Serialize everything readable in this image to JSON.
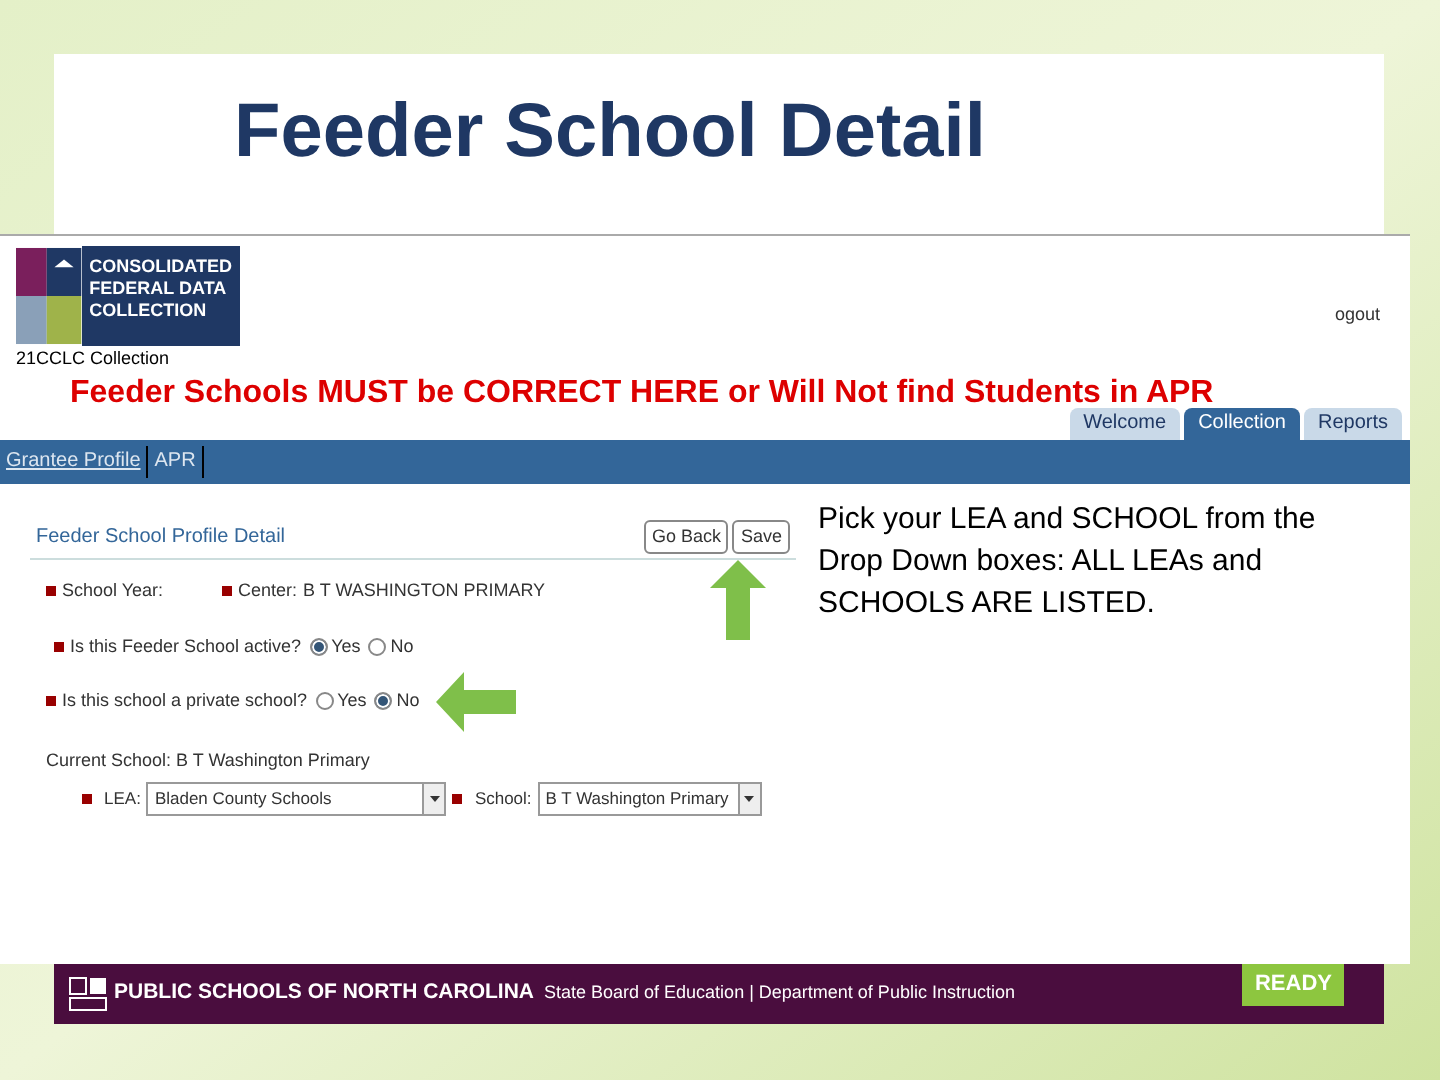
{
  "slide": {
    "title": "Feeder School Detail"
  },
  "banner": {
    "logo_lines": [
      "CONSOLIDATED",
      "FEDERAL DATA",
      "COLLECTION"
    ],
    "collection": "21CCLC Collection",
    "logout": "ogout",
    "notice": "Feeder Schools MUST be CORRECT HERE or Will Not find Students in APR"
  },
  "tabs": [
    {
      "label": "Welcome",
      "selected": false
    },
    {
      "label": "Collection",
      "selected": true
    },
    {
      "label": "Reports",
      "selected": false
    }
  ],
  "nav": [
    "Grantee Profile",
    "APR"
  ],
  "form": {
    "heading": "Feeder School Profile Detail",
    "buttons": [
      "Go Back",
      "Save"
    ],
    "school_year": {
      "label": "School Year:"
    },
    "center": {
      "label": "Center:",
      "value": "B T WASHINGTON PRIMARY"
    },
    "questions": [
      {
        "label": "Is this Feeder School active?",
        "options": [
          {
            "label": "Yes",
            "selected": true
          },
          {
            "label": "No",
            "selected": false
          }
        ]
      },
      {
        "label": "Is this school a private school?",
        "options": [
          {
            "label": "Yes",
            "selected": false
          },
          {
            "label": "No",
            "selected": true
          }
        ]
      }
    ],
    "current_school": "Current School: B T Washington Primary",
    "selects": [
      {
        "label": "LEA:",
        "value": "Bladen County Schools"
      },
      {
        "label": "School:",
        "value": "B T Washington Primary"
      }
    ]
  },
  "callout": "Pick your LEA and SCHOOL from the Drop Down boxes: ALL LEAs and SCHOOLS ARE LISTED.",
  "footer": {
    "org": "PUBLIC SCHOOLS OF NORTH CAROLINA",
    "sub": "State Board of Education | Department of Public Instruction",
    "badge": "READY"
  }
}
